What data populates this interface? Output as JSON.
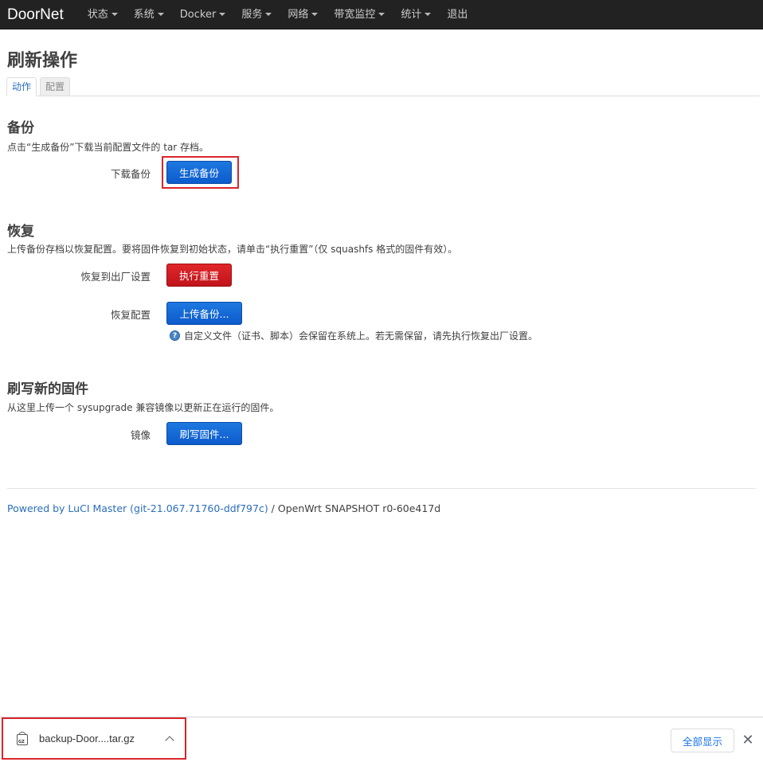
{
  "navbar": {
    "brand": "DoorNet",
    "items": [
      {
        "label": "状态",
        "dropdown": true
      },
      {
        "label": "系统",
        "dropdown": true
      },
      {
        "label": "Docker",
        "dropdown": true
      },
      {
        "label": "服务",
        "dropdown": true
      },
      {
        "label": "网络",
        "dropdown": true
      },
      {
        "label": "带宽监控",
        "dropdown": true
      },
      {
        "label": "统计",
        "dropdown": true
      },
      {
        "label": "退出",
        "dropdown": false
      }
    ]
  },
  "page": {
    "title": "刷新操作",
    "tabs": [
      {
        "label": "动作",
        "active": true
      },
      {
        "label": "配置",
        "active": false
      }
    ]
  },
  "backup": {
    "title": "备份",
    "description": "点击“生成备份”下载当前配置文件的 tar 存档。",
    "download_label": "下载备份",
    "generate_button": "生成备份"
  },
  "restore": {
    "title": "恢复",
    "description": "上传备份存档以恢复配置。要将固件恢复到初始状态，请单击“执行重置”（仅 squashfs 格式的固件有效）。",
    "factory_label": "恢复到出厂设置",
    "reset_button": "执行重置",
    "restore_label": "恢复配置",
    "upload_button": "上传备份...",
    "hint_icon_glyph": "?",
    "hint": "自定义文件（证书、脚本）会保留在系统上。若无需保留，请先执行恢复出厂设置。"
  },
  "flash": {
    "title": "刷写新的固件",
    "description": "从这里上传一个 sysupgrade 兼容镜像以更新正在运行的固件。",
    "image_label": "镜像",
    "flash_button": "刷写固件..."
  },
  "footer": {
    "link": "Powered by LuCI Master (git-21.067.71760-ddf797c)",
    "text": " / OpenWrt SNAPSHOT r0-60e417d"
  },
  "download_bar": {
    "icon_tag": "GZ",
    "filename": "backup-Door....tar.gz",
    "show_all": "全部显示",
    "close_glyph": "✕"
  },
  "colors": {
    "navbar_bg": "#222222",
    "primary_button": "#0d5bcc",
    "danger_button": "#c0141a",
    "link": "#2a6ebb",
    "highlight": "#d9262c"
  }
}
